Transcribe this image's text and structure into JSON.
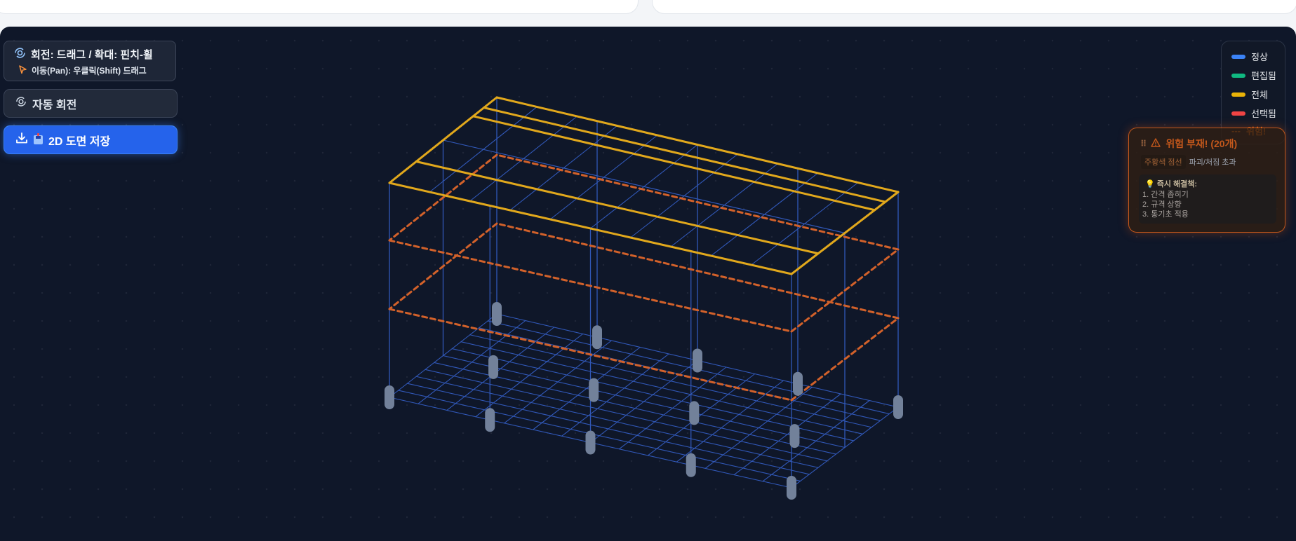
{
  "controls": {
    "hint_title": "회전: 드래그 / 확대: 핀치-휠",
    "hint_subtitle": "이동(Pan): 우클릭(Shift) 드래그",
    "auto_rotate_label": "자동 회전",
    "save_2d_label": "2D 도면 저장"
  },
  "legend": {
    "items": [
      {
        "label": "정상",
        "color": "#3b82f6"
      },
      {
        "label": "편집됨",
        "color": "#10b981"
      },
      {
        "label": "전체",
        "color": "#eab308"
      },
      {
        "label": "선택됨",
        "color": "#ef4444"
      }
    ],
    "danger": {
      "prefix": "---",
      "label": "위험!",
      "color": "#f97316"
    }
  },
  "warning": {
    "title": "위험 부재! (20개)",
    "tag": "주황색 점선",
    "tag_desc": "파괴/처짐 초과",
    "fix_title": "즉시 해결책:",
    "fixes": [
      "1. 간격 좁히기",
      "2. 규격 상향",
      "3. 통기초 적용"
    ]
  },
  "colors": {
    "frame": "#3158b8",
    "selected_all": "#e1a81c",
    "danger": "#d2612a",
    "footing": "#72819a",
    "background": "#0f1729"
  }
}
